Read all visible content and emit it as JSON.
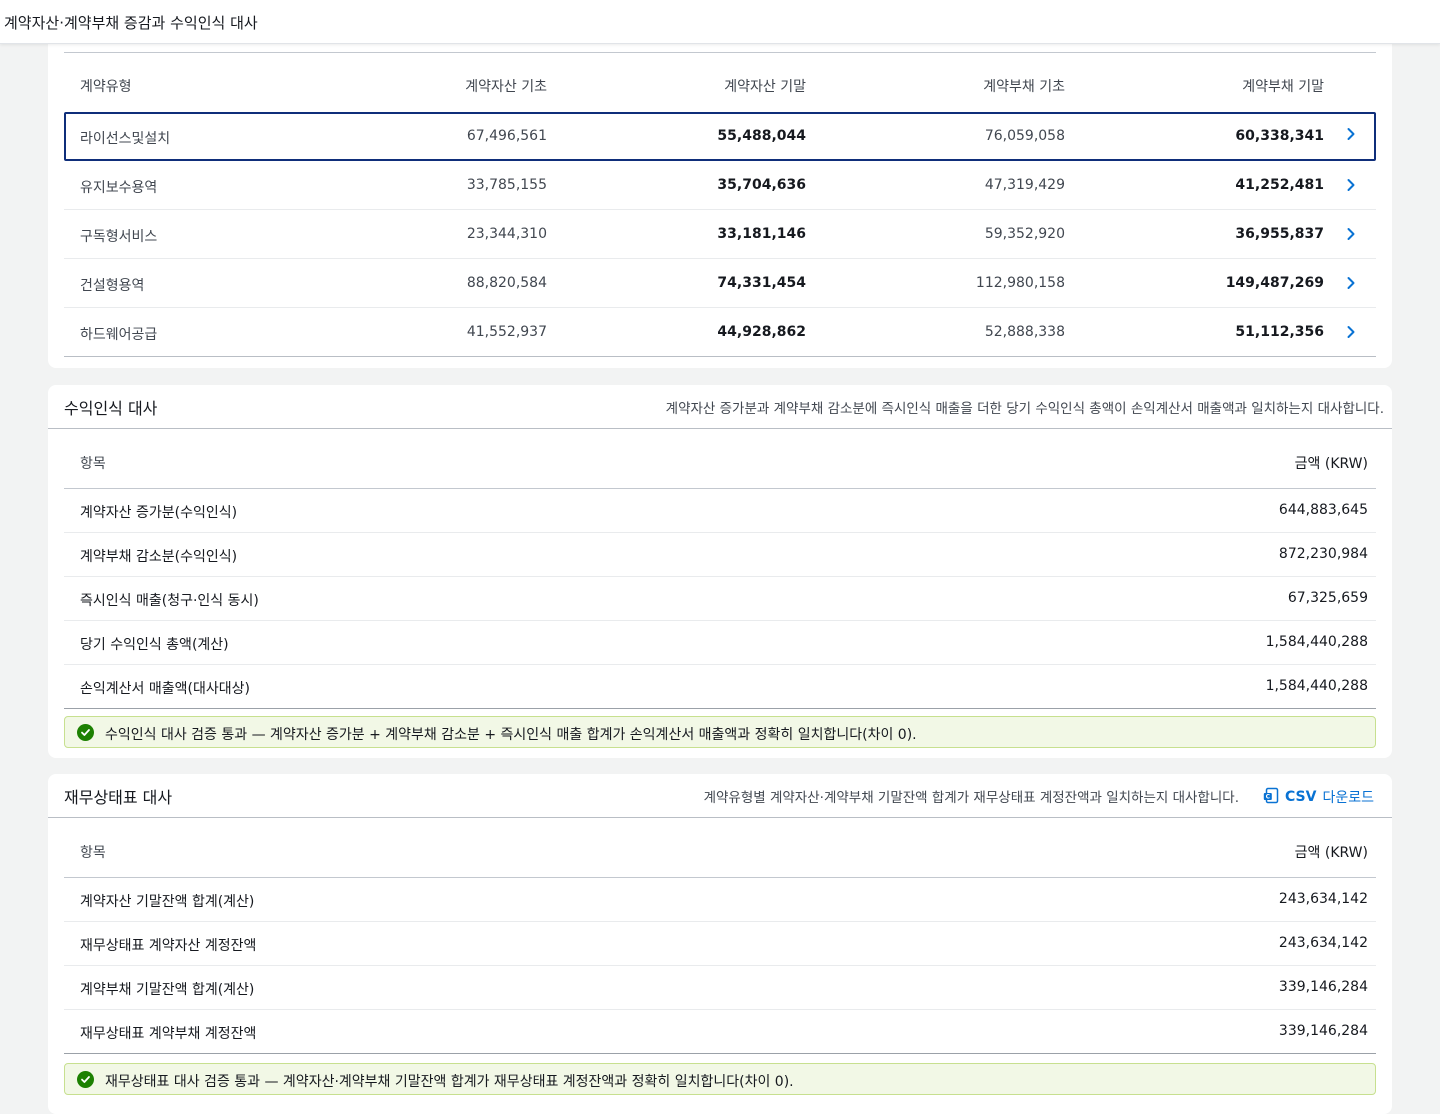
{
  "header": {
    "title": "계약자산·계약부채 증감과 수익인식 대사"
  },
  "contract_table": {
    "columns": [
      "계약유형",
      "계약자산 기초",
      "계약자산 기말",
      "계약부채 기초",
      "계약부채 기말"
    ],
    "rows": [
      {
        "type": "라이선스및설치",
        "asset_open": "67,496,561",
        "asset_close": "55,488,044",
        "liab_open": "76,059,058",
        "liab_close": "60,338,341"
      },
      {
        "type": "유지보수용역",
        "asset_open": "33,785,155",
        "asset_close": "35,704,636",
        "liab_open": "47,319,429",
        "liab_close": "41,252,481"
      },
      {
        "type": "구독형서비스",
        "asset_open": "23,344,310",
        "asset_close": "33,181,146",
        "liab_open": "59,352,920",
        "liab_close": "36,955,837"
      },
      {
        "type": "건설형용역",
        "asset_open": "88,820,584",
        "asset_close": "74,331,454",
        "liab_open": "112,980,158",
        "liab_close": "149,487,269"
      },
      {
        "type": "하드웨어공급",
        "asset_open": "41,552,937",
        "asset_close": "44,928,862",
        "liab_open": "52,888,338",
        "liab_close": "51,112,356"
      }
    ],
    "selected_row": 0
  },
  "revenue_recon": {
    "title": "수익인식 대사",
    "description": "계약자산 증가분과 계약부채 감소분에 즉시인식 매출을 더한 당기 수익인식 총액이 손익계산서 매출액과 일치하는지 대사합니다.",
    "col_item": "항목",
    "col_amount": "금액 (KRW)",
    "rows": [
      {
        "label": "계약자산 증가분(수익인식)",
        "value": "644,883,645"
      },
      {
        "label": "계약부채 감소분(수익인식)",
        "value": "872,230,984"
      },
      {
        "label": "즉시인식 매출(청구·인식 동시)",
        "value": "67,325,659"
      },
      {
        "label": "당기 수익인식 총액(계산)",
        "value": "1,584,440,288"
      },
      {
        "label": "손익계산서 매출액(대사대상)",
        "value": "1,584,440,288"
      }
    ],
    "alert": "수익인식 대사 검증 통과 — 계약자산 증가분 + 계약부채 감소분 + 즉시인식 매출 합계가 손익계산서 매출액과 정확히 일치합니다(차이 0)."
  },
  "bs_recon": {
    "title": "재무상태표 대사",
    "description": "계약유형별 계약자산·계약부채 기말잔액 합계가 재무상태표 계정잔액과 일치하는지 대사합니다.",
    "csv_label": "CSV",
    "csv_label2": "다운로드",
    "col_item": "항목",
    "col_amount": "금액 (KRW)",
    "rows": [
      {
        "label": "계약자산 기말잔액 합계(계산)",
        "value": "243,634,142"
      },
      {
        "label": "재무상태표 계약자산 계정잔액",
        "value": "243,634,142"
      },
      {
        "label": "계약부채 기말잔액 합계(계산)",
        "value": "339,146,284"
      },
      {
        "label": "재무상태표 계약부채 계정잔액",
        "value": "339,146,284"
      }
    ],
    "alert": "재무상태표 대사 검증 통과 — 계약자산·계약부채 기말잔액 합계가 재무상태표 계정잔액과 정확히 일치합니다(차이 0)."
  },
  "colors": {
    "accent": "#0972d3",
    "success": "#1d8102",
    "selected_border": "#0f2e7a"
  }
}
